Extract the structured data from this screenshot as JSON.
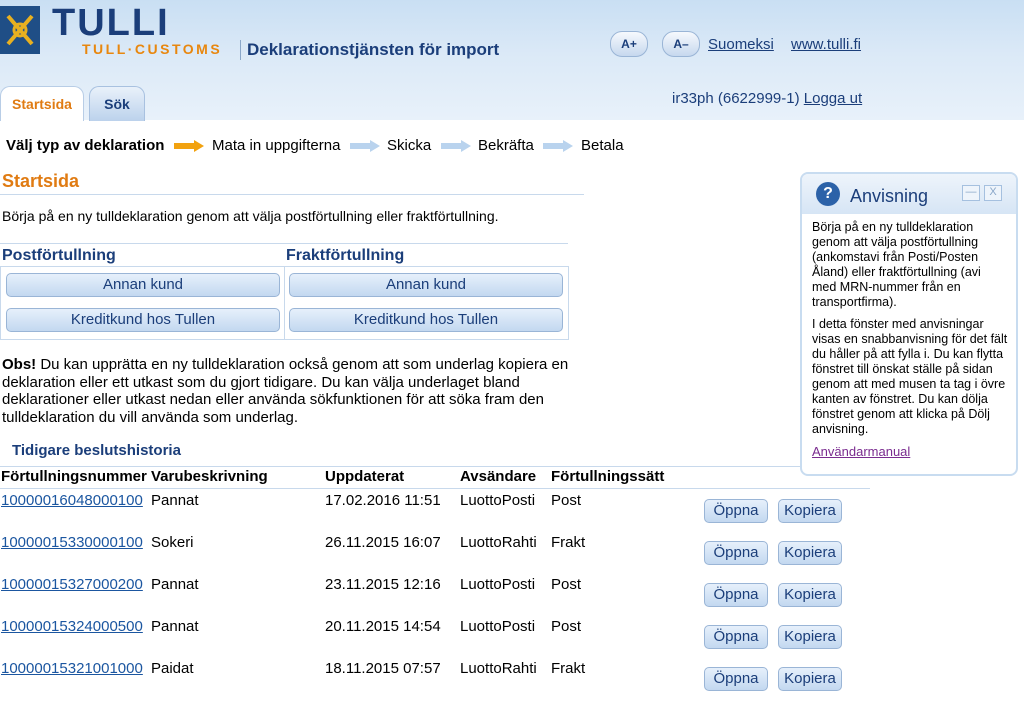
{
  "header": {
    "brand": "TULLI",
    "brand_sub": "TULL·CUSTOMS",
    "service_title": "Deklarationstjänsten för import",
    "font_increase": "A+",
    "font_decrease": "A–",
    "lang_link": "Suomeksi",
    "site_link": "www.tulli.fi"
  },
  "tabs": [
    {
      "label": "Startsida",
      "active": true
    },
    {
      "label": "Sök",
      "active": false
    }
  ],
  "user": {
    "id": "ir33ph (6622999-1)",
    "logout": "Logga ut"
  },
  "steps": [
    "Välj typ av deklaration",
    "Mata in uppgifterna",
    "Skicka",
    "Bekräfta",
    "Betala"
  ],
  "page": {
    "title": "Startsida",
    "intro": "Börja på en ny tulldeklaration genom att välja postförtullning eller fraktförtullning."
  },
  "choices": {
    "post_title": "Postförtullning",
    "frakt_title": "Fraktförtullning",
    "btn_other": "Annan kund",
    "btn_credit": "Kreditkund hos Tullen"
  },
  "obs": {
    "bold": "Obs!",
    "text": " Du kan upprätta en ny tulldeklaration också genom att som underlag kopiera en deklaration eller ett utkast som du gjort tidigare. Du kan välja underlaget bland deklarationer eller utkast nedan eller använda sökfunktionen för att söka fram den tulldeklaration du vill använda som underlag."
  },
  "history": {
    "title": "Tidigare beslutshistoria",
    "columns": [
      "Förtullningsnummer",
      "Varubeskrivning",
      "Uppdaterat",
      "Avsändare",
      "Förtullningssätt"
    ],
    "open_label": "Öppna",
    "copy_label": "Kopiera",
    "rows": [
      {
        "number": "10000016048000100",
        "desc": "Pannat",
        "updated": "17.02.2016 11:51",
        "sender": "LuottoPosti",
        "method": "Post"
      },
      {
        "number": "10000015330000100",
        "desc": "Sokeri",
        "updated": "26.11.2015 16:07",
        "sender": "LuottoRahti",
        "method": "Frakt"
      },
      {
        "number": "10000015327000200",
        "desc": "Pannat",
        "updated": "23.11.2015 12:16",
        "sender": "LuottoPosti",
        "method": "Post"
      },
      {
        "number": "10000015324000500",
        "desc": "Pannat",
        "updated": "20.11.2015 14:54",
        "sender": "LuottoPosti",
        "method": "Post"
      },
      {
        "number": "10000015321001000",
        "desc": "Paidat",
        "updated": "18.11.2015 07:57",
        "sender": "LuottoRahti",
        "method": "Frakt"
      }
    ]
  },
  "help_panel": {
    "title": "Anvisning",
    "minimize": "—",
    "close": "X",
    "icon_glyph": "?",
    "p1": "Börja på en ny tulldeklaration genom att välja postförtullning (ankomstavi från Posti/Posten Åland) eller fraktförtullning (avi med MRN-nummer från en transportfirma).",
    "p2": "I detta fönster med anvisningar visas en snabbanvisning för det fält du håller på att fylla i. Du kan flytta fönstret till önskat ställe på sidan genom att med musen ta tag i övre kanten av fönstret. Du kan dölja fönstret genom att klicka på Dölj anvisning.",
    "manual_link": "Användarmanual"
  },
  "colors": {
    "brand_blue": "#1b3e7a",
    "accent_orange": "#e07b12",
    "link_blue": "#1b56a0",
    "visited_purple": "#7a2b8f"
  }
}
